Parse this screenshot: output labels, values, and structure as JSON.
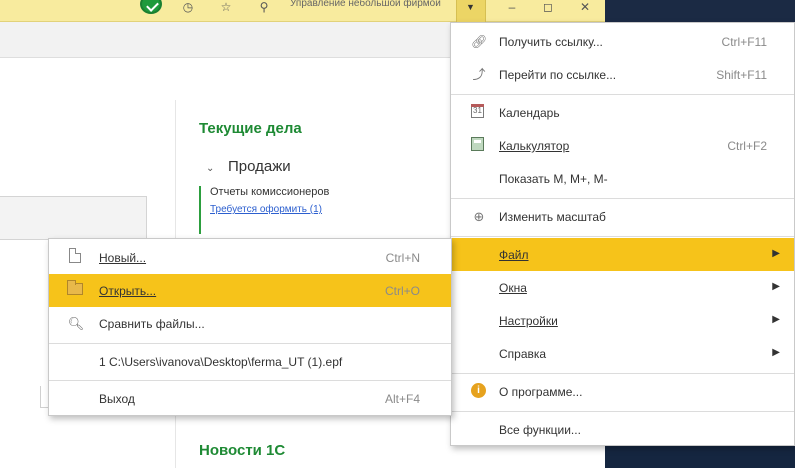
{
  "main_menu": {
    "items": [
      {
        "label": "Получить ссылку...",
        "shortcut": "Ctrl+F11",
        "icon": "link-icon"
      },
      {
        "label": "Перейти по ссылке...",
        "shortcut": "Shift+F11",
        "icon": "goto-link-icon"
      },
      {
        "label": "Календарь",
        "shortcut": "",
        "icon": "calendar-icon"
      },
      {
        "label": "Калькулятор",
        "shortcut": "Ctrl+F2",
        "icon": "calculator-icon"
      },
      {
        "label": "Показать M, M+, M-",
        "shortcut": "",
        "icon": ""
      },
      {
        "label": "Изменить масштаб",
        "shortcut": "",
        "icon": "zoom-icon"
      },
      {
        "label": "Файл",
        "shortcut": "",
        "icon": ""
      },
      {
        "label": "Окна",
        "shortcut": "",
        "icon": ""
      },
      {
        "label": "Настройки",
        "shortcut": "",
        "icon": ""
      },
      {
        "label": "Справка",
        "shortcut": "",
        "icon": ""
      },
      {
        "label": "О программе...",
        "shortcut": "",
        "icon": "info-icon"
      },
      {
        "label": "Все функции...",
        "shortcut": "",
        "icon": ""
      }
    ],
    "submenu_arrow": "▶",
    "highlight_color": "#f6c31a"
  },
  "file_menu": {
    "items": [
      {
        "label": "Новый...",
        "shortcut": "Ctrl+N",
        "icon": "new-document-icon"
      },
      {
        "label": "Открыть...",
        "shortcut": "Ctrl+O",
        "icon": "open-folder-icon"
      },
      {
        "label": "Сравнить файлы...",
        "shortcut": "",
        "icon": "compare-files-icon"
      },
      {
        "label": "1 C:\\Users\\ivanova\\Desktop\\ferma_UT (1).epf",
        "shortcut": "",
        "icon": ""
      },
      {
        "label": "Выход",
        "shortcut": "Alt+F4",
        "icon": ""
      }
    ]
  },
  "content": {
    "current_tasks_title": "Текущие дела",
    "sales_label": "Продажи",
    "reports_title": "Отчеты комиссионеров",
    "reports_link": "Требуется оформить (1)",
    "news_title": "Новости 1С"
  },
  "titlebar": {
    "title": "Управление небольшой фирмой"
  },
  "colors": {
    "titlebar": "#f8eb9e",
    "accent_green": "#1e8a34",
    "highlight": "#f6c31a",
    "dark_background": "#152640"
  }
}
